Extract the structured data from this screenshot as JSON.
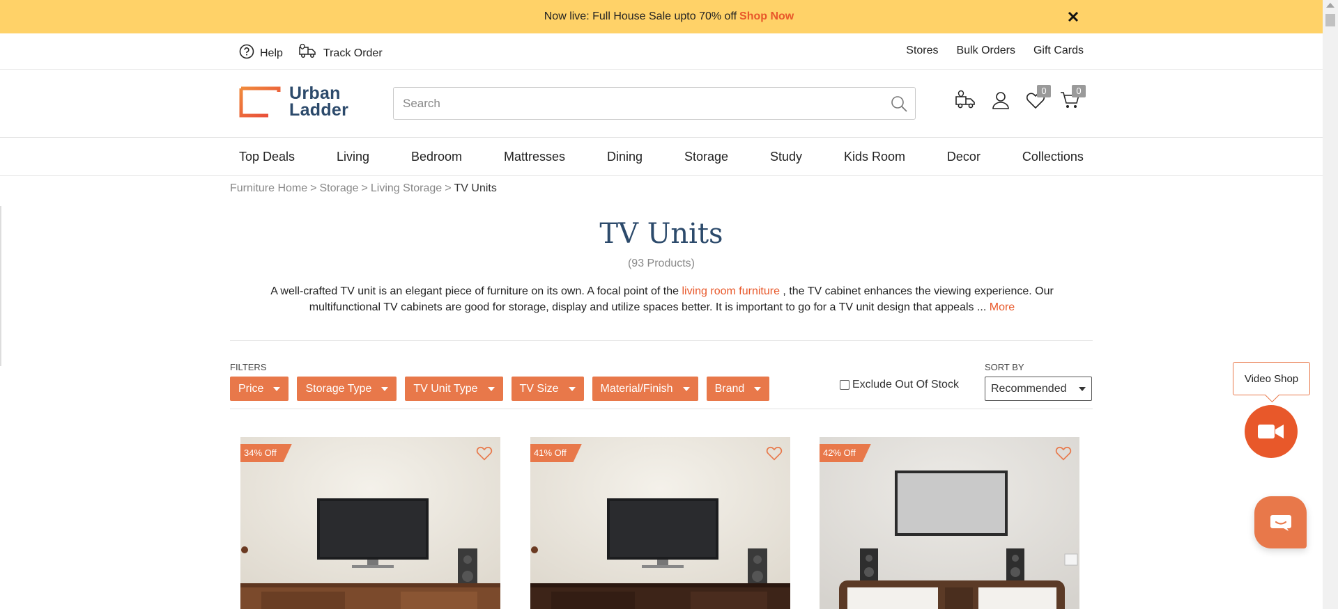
{
  "promo": {
    "text": "Now live: Full House Sale upto 70% off",
    "link": "Shop Now"
  },
  "utility": {
    "help": "Help",
    "track_order": "Track Order",
    "stores": "Stores",
    "bulk_orders": "Bulk Orders",
    "gift_cards": "Gift Cards"
  },
  "logo": {
    "line1": "Urban",
    "line2": "Ladder"
  },
  "search": {
    "placeholder": "Search"
  },
  "header_icons": {
    "wishlist_count": "0",
    "cart_count": "0"
  },
  "nav": [
    "Top Deals",
    "Living",
    "Bedroom",
    "Mattresses",
    "Dining",
    "Storage",
    "Study",
    "Kids Room",
    "Decor",
    "Collections"
  ],
  "breadcrumb": [
    "Furniture Home",
    "Storage",
    "Living Storage"
  ],
  "breadcrumb_current": "TV Units",
  "breadcrumb_sep": ">",
  "page": {
    "title": "TV Units",
    "count": "(93 Products)",
    "desc_part1": "A well-crafted TV unit is an elegant piece of furniture on its own. A focal point of the",
    "desc_link": "living room furniture",
    "desc_part2": ", the TV cabinet enhances the viewing experience. Our multifunctional TV cabinets are good for storage, display and utilize spaces better. It is important to go for a TV unit design that appeals ...",
    "desc_more": "More"
  },
  "filters": {
    "label": "FILTERS",
    "buttons": [
      "Price",
      "Storage Type",
      "TV Unit Type",
      "TV Size",
      "Material/Finish",
      "Brand"
    ]
  },
  "exclude_out_of_stock": "Exclude Out Of Stock",
  "sort": {
    "label": "SORT BY",
    "value": "Recommended"
  },
  "products": [
    {
      "discount": "34% Off"
    },
    {
      "discount": "41% Off"
    },
    {
      "discount": "42% Off"
    }
  ],
  "video_shop": {
    "label": "Video Shop"
  },
  "colors": {
    "accent": "#e8784a",
    "promo_bg": "#ffd268",
    "brand_navy": "#2c4a6b"
  }
}
